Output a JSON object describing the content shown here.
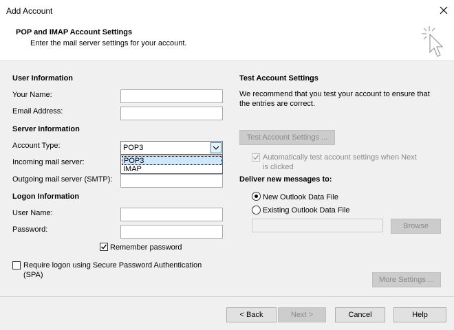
{
  "window": {
    "title": "Add Account"
  },
  "header": {
    "title": "POP and IMAP Account Settings",
    "subtitle": "Enter the mail server settings for your account."
  },
  "user_info": {
    "heading": "User Information",
    "your_name_label": "Your Name:",
    "your_name_value": "",
    "email_label": "Email Address:",
    "email_value": ""
  },
  "server_info": {
    "heading": "Server Information",
    "account_type_label": "Account Type:",
    "account_type_value": "POP3",
    "account_type_options": [
      "POP3",
      "IMAP"
    ],
    "incoming_label": "Incoming mail server:",
    "outgoing_label": "Outgoing mail server (SMTP):"
  },
  "logon_info": {
    "heading": "Logon Information",
    "username_label": "User Name:",
    "password_label": "Password:",
    "remember_label": "Remember password",
    "remember_checked": true,
    "spa_label_line1": "Require logon using Secure Password Authentication",
    "spa_label_line2": "(SPA)",
    "spa_checked": false
  },
  "test_settings": {
    "heading": "Test Account Settings",
    "desc_line1": "We recommend that you test your account to ensure that",
    "desc_line2": "the entries are correct.",
    "test_button": "Test Account Settings ...",
    "auto_test_line1": "Automatically test account settings when Next",
    "auto_test_line2": "is clicked"
  },
  "deliver": {
    "heading": "Deliver new messages to:",
    "new_file_label": "New Outlook Data File",
    "existing_file_label": "Existing Outlook Data File",
    "browse_button": "Browse"
  },
  "more_settings_button": "More Settings ...",
  "footer": {
    "back": "< Back",
    "next": "Next >",
    "cancel": "Cancel",
    "help": "Help"
  }
}
